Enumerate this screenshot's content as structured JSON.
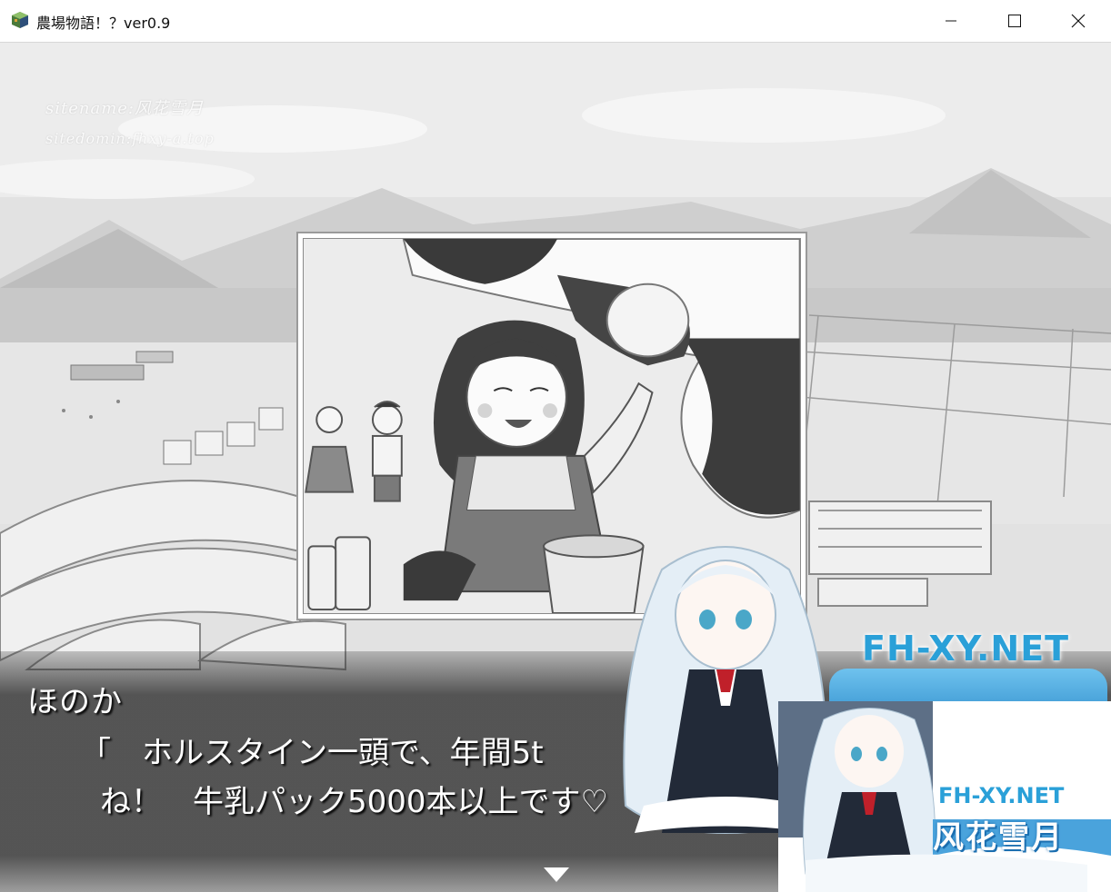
{
  "window": {
    "title": "農場物語！？ver0.9",
    "icon": "rpg-cube-icon",
    "minimize_icon": "minimize-icon",
    "maximize_icon": "maximize-icon",
    "close_icon": "close-icon"
  },
  "watermark": {
    "line1": "sitename:风花雪月",
    "line2": "sitedomin:fhxy-a.top"
  },
  "message": {
    "speaker": "ほのか",
    "line1": "「　ホルスタイン一頭で、年間5t",
    "line2": "ね！　牛乳パック5000本以上です♡",
    "next_icon": "next-triangle-icon"
  },
  "overlay": {
    "site": "FH-XY.NET",
    "thumb_site": "FH-XY.NET",
    "thumb_name": "风花雪月"
  },
  "colors": {
    "message_bg": "#1e1e1e",
    "banner_blue": "#3a97d2",
    "site_text": "#2aa0d8"
  }
}
